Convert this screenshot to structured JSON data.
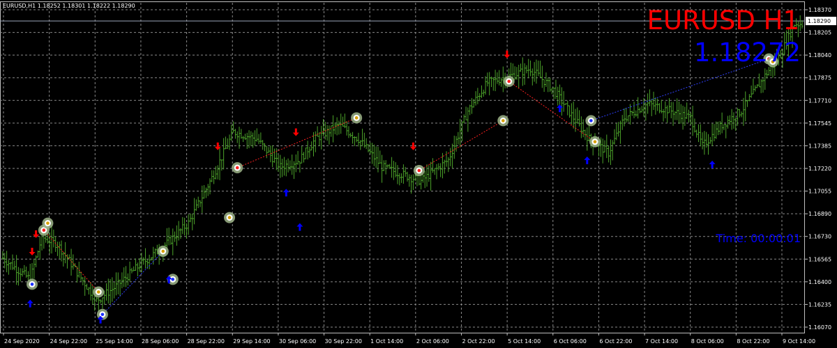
{
  "header": {
    "ohlc_line": "EURUSD,H1  1.18252 1.18301 1.18222 1.18290"
  },
  "overlay": {
    "symbol_timeframe": "EURUSD H1",
    "big_price": "1.18272",
    "timer": "Time: 00:00:01"
  },
  "colors": {
    "background": "#000000",
    "grid": "#8a8a8a",
    "candles": "#4ca32a",
    "sell_arrow": "#ff0000",
    "buy_arrow": "#0000ff",
    "signal_ring": "#9fb58a",
    "symbol_text": "#ff0000",
    "price_text": "#0000ff"
  },
  "chart_data": {
    "type": "bar",
    "symbol": "EURUSD",
    "timeframe": "H1",
    "ylim": [
      1.1607,
      1.1837
    ],
    "current_price": 1.1829,
    "y_ticks": [
      "1.18370",
      "1.18205",
      "1.18040",
      "1.17875",
      "1.17710",
      "1.17545",
      "1.17385",
      "1.17220",
      "1.17055",
      "1.16890",
      "1.16730",
      "1.16565",
      "1.16400",
      "1.16235",
      "1.16070"
    ],
    "x_ticks": [
      "24 Sep 2020",
      "24 Sep 22:00",
      "25 Sep 14:00",
      "28 Sep 06:00",
      "28 Sep 22:00",
      "29 Sep 14:00",
      "30 Sep 06:00",
      "30 Sep 22:00",
      "1 Oct 14:00",
      "2 Oct 06:00",
      "2 Oct 22:00",
      "5 Oct 14:00",
      "6 Oct 06:00",
      "6 Oct 22:00",
      "7 Oct 14:00",
      "8 Oct 06:00",
      "8 Oct 22:00",
      "9 Oct 14:00"
    ],
    "price_path_anchors": [
      {
        "t": 0,
        "p": 1.166
      },
      {
        "t": 14,
        "p": 1.1645
      },
      {
        "t": 20,
        "p": 1.1675
      },
      {
        "t": 28,
        "p": 1.167
      },
      {
        "t": 38,
        "p": 1.165
      },
      {
        "t": 48,
        "p": 1.163
      },
      {
        "t": 58,
        "p": 1.164
      },
      {
        "t": 70,
        "p": 1.1655
      },
      {
        "t": 82,
        "p": 1.1668
      },
      {
        "t": 95,
        "p": 1.1685
      },
      {
        "t": 108,
        "p": 1.172
      },
      {
        "t": 118,
        "p": 1.175
      },
      {
        "t": 130,
        "p": 1.1745
      },
      {
        "t": 142,
        "p": 1.1725
      },
      {
        "t": 152,
        "p": 1.173
      },
      {
        "t": 160,
        "p": 1.1745
      },
      {
        "t": 172,
        "p": 1.1755
      },
      {
        "t": 182,
        "p": 1.1745
      },
      {
        "t": 194,
        "p": 1.1725
      },
      {
        "t": 204,
        "p": 1.172
      },
      {
        "t": 214,
        "p": 1.1715
      },
      {
        "t": 228,
        "p": 1.173
      },
      {
        "t": 238,
        "p": 1.1765
      },
      {
        "t": 248,
        "p": 1.1785
      },
      {
        "t": 260,
        "p": 1.179
      },
      {
        "t": 270,
        "p": 1.1795
      },
      {
        "t": 282,
        "p": 1.178
      },
      {
        "t": 292,
        "p": 1.176
      },
      {
        "t": 300,
        "p": 1.1745
      },
      {
        "t": 310,
        "p": 1.1735
      },
      {
        "t": 318,
        "p": 1.176
      },
      {
        "t": 330,
        "p": 1.177
      },
      {
        "t": 342,
        "p": 1.1765
      },
      {
        "t": 352,
        "p": 1.176
      },
      {
        "t": 358,
        "p": 1.174
      },
      {
        "t": 368,
        "p": 1.1755
      },
      {
        "t": 378,
        "p": 1.1765
      },
      {
        "t": 390,
        "p": 1.179
      },
      {
        "t": 398,
        "p": 1.1805
      },
      {
        "t": 405,
        "p": 1.1827
      }
    ],
    "sell_signals": [
      {
        "t": 15,
        "p": 1.16625
      },
      {
        "t": 17,
        "p": 1.1675
      },
      {
        "t": 110,
        "p": 1.17375
      },
      {
        "t": 150,
        "p": 1.17475
      },
      {
        "t": 210,
        "p": 1.17375
      },
      {
        "t": 258,
        "p": 1.1803
      }
    ],
    "buy_signals": [
      {
        "t": 14,
        "p": 1.163
      },
      {
        "t": 50,
        "p": 1.16185
      },
      {
        "t": 85,
        "p": 1.1647
      },
      {
        "t": 145,
        "p": 1.1709
      },
      {
        "t": 152,
        "p": 1.16845
      },
      {
        "t": 285,
        "p": 1.1769
      },
      {
        "t": 299,
        "p": 1.1732
      },
      {
        "t": 363,
        "p": 1.1729
      }
    ],
    "ring_signals": [
      {
        "t": 15,
        "p": 1.16415,
        "dot": "blue"
      },
      {
        "t": 21,
        "p": 1.168,
        "dot": "red"
      },
      {
        "t": 23,
        "p": 1.1685,
        "dot": "gold"
      },
      {
        "t": 49,
        "p": 1.1636,
        "dot": "gold"
      },
      {
        "t": 51,
        "p": 1.162,
        "dot": "blue"
      },
      {
        "t": 82,
        "p": 1.1665,
        "dot": "gold"
      },
      {
        "t": 87,
        "p": 1.1645,
        "dot": "blue"
      },
      {
        "t": 116,
        "p": 1.1689,
        "dot": "gold"
      },
      {
        "t": 120,
        "p": 1.17245,
        "dot": "red"
      },
      {
        "t": 181,
        "p": 1.176,
        "dot": "gold"
      },
      {
        "t": 213,
        "p": 1.17225,
        "dot": "red"
      },
      {
        "t": 256,
        "p": 1.1758,
        "dot": "gold"
      },
      {
        "t": 259,
        "p": 1.1786,
        "dot": "red"
      },
      {
        "t": 301,
        "p": 1.1758,
        "dot": "blue"
      },
      {
        "t": 303,
        "p": 1.1743,
        "dot": "gold"
      },
      {
        "t": 392,
        "p": 1.1802,
        "dot": "red"
      },
      {
        "t": 394,
        "p": 1.18,
        "dot": "gold"
      }
    ],
    "connectors": [
      {
        "from": {
          "t": 21,
          "p": 1.168
        },
        "to": {
          "t": 49,
          "p": 1.1636
        },
        "color": "red"
      },
      {
        "from": {
          "t": 51,
          "p": 1.162
        },
        "to": {
          "t": 82,
          "p": 1.1665
        },
        "color": "blue"
      },
      {
        "from": {
          "t": 120,
          "p": 1.17245
        },
        "to": {
          "t": 181,
          "p": 1.176
        },
        "color": "red"
      },
      {
        "from": {
          "t": 213,
          "p": 1.17225
        },
        "to": {
          "t": 256,
          "p": 1.1758
        },
        "color": "red"
      },
      {
        "from": {
          "t": 259,
          "p": 1.1786
        },
        "to": {
          "t": 303,
          "p": 1.1743
        },
        "color": "red"
      },
      {
        "from": {
          "t": 301,
          "p": 1.1758
        },
        "to": {
          "t": 392,
          "p": 1.1802
        },
        "color": "blue"
      }
    ],
    "grid": true
  }
}
